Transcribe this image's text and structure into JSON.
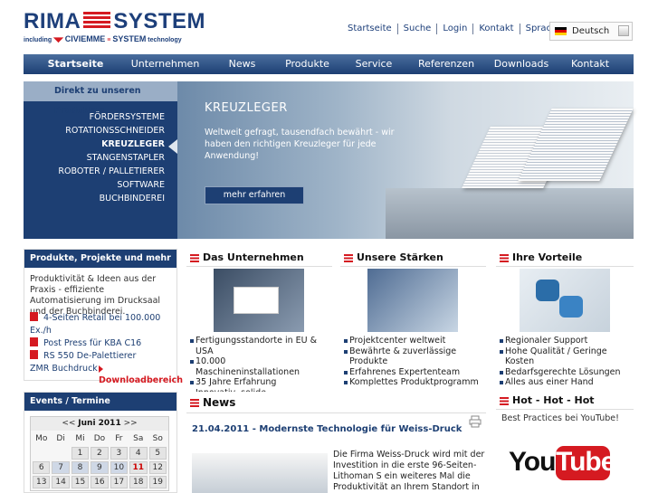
{
  "header": {
    "logo_main_left": "RIMA",
    "logo_main_right": "SYSTEM",
    "logo_sub_prefix": "including",
    "logo_sub_civ": "CIVIEMME",
    "logo_sub_sys": "SYSTEM",
    "logo_sub_suffix": "technology",
    "topnav": [
      "Startseite",
      "Suche",
      "Login",
      "Kontakt",
      "Sprache"
    ],
    "language": "Deutsch"
  },
  "mainnav": [
    "Startseite",
    "Unternehmen",
    "News",
    "Produkte",
    "Service",
    "Referenzen",
    "Downloads",
    "Kontakt"
  ],
  "hero": {
    "products_heading": "Direkt zu unseren Produkten",
    "products": [
      "FÖRDERSYSTEME",
      "ROTATIONSSCHNEIDER",
      "KREUZLEGER",
      "STANGENSTAPLER",
      "ROBOTER / PALLETIERER",
      "SOFTWARE",
      "BUCHBINDEREI"
    ],
    "selected_product": "KREUZLEGER",
    "title": "KREUZLEGER",
    "text": "Weltweit gefragt, tausendfach bewährt - wir haben den richtigen Kreuzleger für jede Anwendung!",
    "button": "mehr erfahren"
  },
  "left_box": {
    "heading": "Produkte, Projekte und mehr",
    "text": "Produktivität & Ideen aus der Praxis - effiziente Automatisierung im Drucksaal und der Buchbinderei.",
    "links": [
      "4-Seiten Retail bei 100.000 Ex./h",
      "Post Press für KBA C16",
      "RS 550 De-Palettierer"
    ],
    "plain_link": "ZMR Buchdruck",
    "download": "Downloadbereich"
  },
  "cards": [
    {
      "title": "Das Unternehmen",
      "items": [
        "Fertigungsstandorte in EU & USA",
        "10.000 Maschineninstallationen",
        "35 Jahre Erfahrung",
        "Innovativ, solide, familiengeführt"
      ]
    },
    {
      "title": "Unsere Stärken",
      "items": [
        "Projektcenter weltweit",
        "Bewährte & zuverlässige Produkte",
        "Erfahrenes Expertenteam",
        "Komplettes Produktprogramm"
      ]
    },
    {
      "title": "Ihre Vorteile",
      "items": [
        "Regionaler Support",
        "Hohe Qualität / Geringe Kosten",
        "Bedarfsgerechte Lösungen",
        "Alles aus einer Hand"
      ]
    }
  ],
  "events": {
    "heading": "Events / Termine",
    "prev": "<<",
    "month": "Juni 2011",
    "next": ">>",
    "weekdays": [
      "Mo",
      "Di",
      "Mi",
      "Do",
      "Fr",
      "Sa",
      "So"
    ],
    "weeks": [
      [
        "",
        "",
        "1",
        "2",
        "3",
        "4",
        "5"
      ],
      [
        "6",
        "7",
        "8",
        "9",
        "10",
        "11",
        "12"
      ],
      [
        "13",
        "14",
        "15",
        "16",
        "17",
        "18",
        "19"
      ]
    ]
  },
  "news": {
    "title": "News",
    "headline": "21.04.2011 - Modernste Technologie für Weiss-Druck",
    "text": "Die Firma Weiss-Druck wird mit der Investition in die erste 96-Seiten-Lithoman S ein weiteres Mal die Produktivität an Ihrem Standort in"
  },
  "youtube": {
    "title": "Hot - Hot - Hot",
    "subtitle": "Best Practices bei YouTube!",
    "logo_you": "You",
    "logo_tube": "Tube"
  },
  "colors": {
    "brand_blue": "#1d3f73",
    "brand_red": "#d51a21"
  }
}
